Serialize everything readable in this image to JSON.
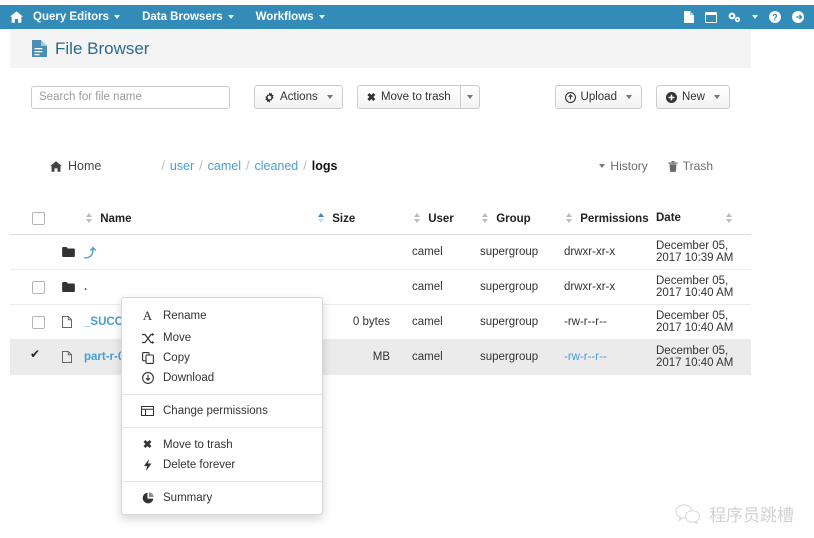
{
  "navbar": {
    "home_icon": "home-icon",
    "menus": [
      {
        "label": "Query Editors",
        "icon": "chevron-down-icon"
      },
      {
        "label": "Data Browsers",
        "icon": "chevron-down-icon"
      },
      {
        "label": "Workflows",
        "icon": "chevron-down-icon"
      }
    ],
    "right_icons": [
      "document-icon",
      "window-icon",
      "gears-icon",
      "chevron-down-icon",
      "help-circle-icon",
      "logout-icon"
    ]
  },
  "header": {
    "title": "File Browser",
    "title_icon": "file-browser-icon"
  },
  "toolbar": {
    "search_placeholder": "Search for file name",
    "search_value": "",
    "actions_label": "Actions",
    "actions_icon": "gear-icon",
    "move_to_trash_label": "Move to trash",
    "move_to_trash_icon": "times-icon",
    "upload_label": "Upload",
    "upload_icon": "upload-circle-icon",
    "new_label": "New",
    "new_icon": "plus-circle-icon"
  },
  "breadcrumb": {
    "home_label": "Home",
    "home_icon": "home-icon",
    "separator": "/",
    "path": [
      {
        "label": "user",
        "current": false
      },
      {
        "label": "camel",
        "current": false
      },
      {
        "label": "cleaned",
        "current": false
      },
      {
        "label": "logs",
        "current": true
      }
    ],
    "history_label": "History",
    "history_icon": "caret-down-icon",
    "trash_label": "Trash",
    "trash_icon": "trash-icon"
  },
  "table": {
    "columns": [
      "Name",
      "Size",
      "User",
      "Group",
      "Permissions",
      "Date"
    ],
    "sort_column": "Size",
    "sort_direction": "asc",
    "rows": [
      {
        "checkbox": "none",
        "icon": "folder-icon",
        "name": "..",
        "name_glyph": "⤴",
        "size": "",
        "user": "camel",
        "group": "supergroup",
        "permissions": "drwxr-xr-x",
        "date": "December 05, 2017 10:39 AM",
        "selected": false
      },
      {
        "checkbox": "unchecked",
        "icon": "folder-icon",
        "name": ".",
        "name_glyph": ".",
        "size": "",
        "user": "camel",
        "group": "supergroup",
        "permissions": "drwxr-xr-x",
        "date": "December 05, 2017 10:40 AM",
        "selected": false
      },
      {
        "checkbox": "unchecked",
        "icon": "file-icon",
        "name": "_SUCCESS",
        "name_glyph": "_SUCCESS",
        "size": "0 bytes",
        "user": "camel",
        "group": "supergroup",
        "permissions": "-rw-r--r--",
        "date": "December 05, 2017 10:40 AM",
        "selected": false
      },
      {
        "checkbox": "checked",
        "icon": "file-icon",
        "name": "part-r-000",
        "name_glyph": "part-r-000",
        "size": "MB",
        "user": "camel",
        "group": "supergroup",
        "permissions": "-rw-r--r--",
        "date": "December 05, 2017 10:40 AM",
        "selected": true
      }
    ]
  },
  "context_menu": {
    "groups": [
      [
        {
          "label": "Rename",
          "icon": "text-a-icon"
        },
        {
          "label": "Move",
          "icon": "shuffle-arrows-icon"
        },
        {
          "label": "Copy",
          "icon": "copy-icon"
        },
        {
          "label": "Download",
          "icon": "download-circle-icon"
        }
      ],
      [
        {
          "label": "Change permissions",
          "icon": "list-table-icon"
        }
      ],
      [
        {
          "label": "Move to trash",
          "icon": "times-icon"
        },
        {
          "label": "Delete forever",
          "icon": "bolt-icon"
        }
      ],
      [
        {
          "label": "Summary",
          "icon": "pie-chart-icon"
        }
      ]
    ]
  },
  "watermark": {
    "text": "程序员跳槽",
    "icon": "wechat-icon"
  },
  "colors": {
    "navbar_blue": "#338bb8",
    "link_blue": "#4a9ed0",
    "title_blue": "#2b6a8f",
    "selected_row": "#ebebeb"
  }
}
